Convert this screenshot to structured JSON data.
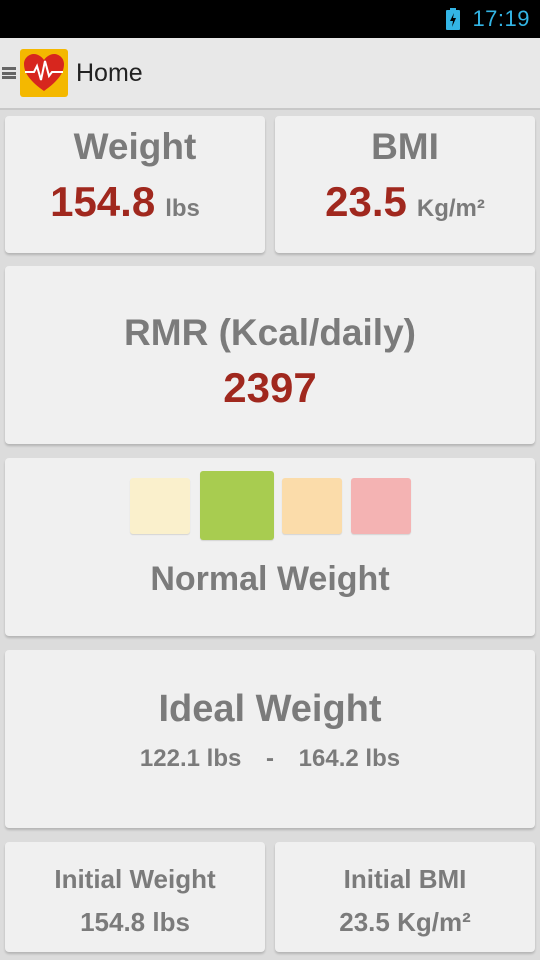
{
  "status_bar": {
    "time": "17:19"
  },
  "action_bar": {
    "title": "Home"
  },
  "weight": {
    "title": "Weight",
    "value": "154.8",
    "unit": "lbs"
  },
  "bmi": {
    "title": "BMI",
    "value": "23.5",
    "unit": "Kg/m²"
  },
  "rmr": {
    "title": "RMR (Kcal/daily)",
    "value": "2397"
  },
  "category": {
    "label": "Normal Weight",
    "swatch_colors": [
      "#faf0cc",
      "#a8cc50",
      "#fbdcaa",
      "#f4b3b3"
    ],
    "selected_index": 1
  },
  "ideal_weight": {
    "title": "Ideal Weight",
    "min": "122.1 lbs",
    "separator": "-",
    "max": "164.2 lbs"
  },
  "initial_weight": {
    "title": "Initial Weight",
    "value": "154.8 lbs"
  },
  "initial_bmi": {
    "title": "Initial BMI",
    "value": "23.5 Kg/m²"
  },
  "colors": {
    "accent_value": "#a0281e",
    "label_gray": "#7b7b7b",
    "status_blue": "#33b5e5"
  },
  "icons": {
    "battery": "battery-charging-icon",
    "drawer": "menu-icon",
    "logo": "heart-pulse-icon"
  }
}
